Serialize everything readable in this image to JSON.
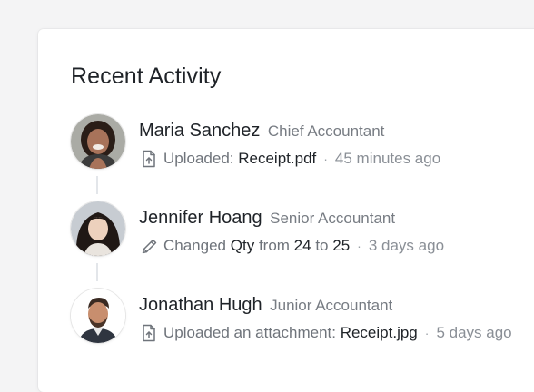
{
  "title": "Recent Activity",
  "activities": [
    {
      "name": "Maria Sanchez",
      "role": "Chief Accountant",
      "action_icon": "file-upload-icon",
      "action_prefix": "Uploaded:",
      "file": "Receipt.pdf",
      "time": "45 minutes ago"
    },
    {
      "name": "Jennifer Hoang",
      "role": "Senior Accountant",
      "action_icon": "pencil-icon",
      "action_prefix": "Changed",
      "field": "Qty",
      "from_word": "from",
      "from_value": "24",
      "to_word": "to",
      "to_value": "25",
      "time": "3 days ago"
    },
    {
      "name": "Jonathan Hugh",
      "role": "Junior Accountant",
      "action_icon": "file-upload-icon",
      "action_prefix": "Uploaded an attachment:",
      "file": "Receipt.jpg",
      "time": "5 days ago"
    }
  ],
  "separator": "·",
  "colors": {
    "background": "#f4f4f5",
    "card": "#ffffff",
    "text_primary": "#1f2328",
    "text_secondary": "#777c83",
    "connector": "#e3e6ea"
  }
}
